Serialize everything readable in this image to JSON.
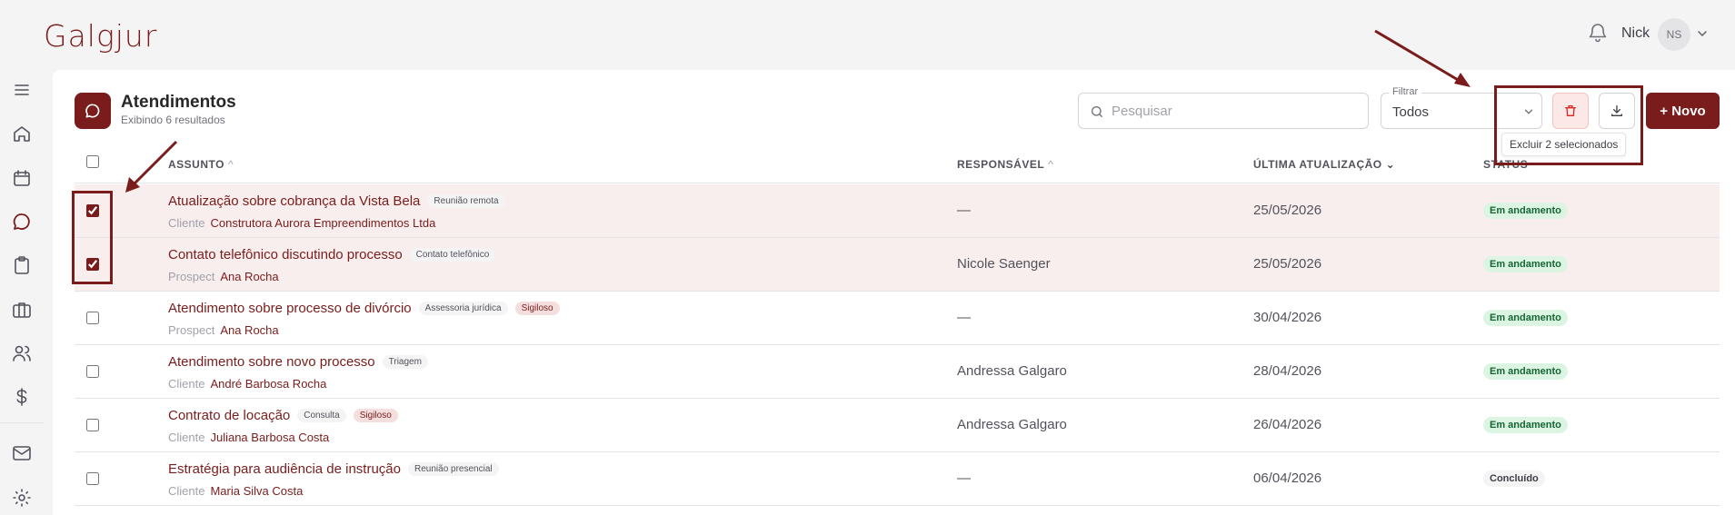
{
  "app": {
    "logo": "Galgjur"
  },
  "header": {
    "user_name": "Nick",
    "user_initials": "NS"
  },
  "sidebar": {
    "items": [
      {
        "name": "menu-icon"
      },
      {
        "name": "home-icon"
      },
      {
        "name": "calendar-icon"
      },
      {
        "name": "chat-icon",
        "active": true
      },
      {
        "name": "clipboard-icon"
      },
      {
        "name": "briefcase-icon"
      },
      {
        "name": "users-icon"
      },
      {
        "name": "dollar-icon"
      },
      {
        "name": "mail-icon"
      },
      {
        "name": "gear-icon"
      }
    ]
  },
  "page": {
    "title": "Atendimentos",
    "subtitle": "Exibindo 6 resultados"
  },
  "toolbar": {
    "search_placeholder": "Pesquisar",
    "filter_label": "Filtrar",
    "filter_value": "Todos",
    "delete_tooltip": "Excluir 2 selecionados",
    "new_label": "+ Novo"
  },
  "table": {
    "headers": {
      "subject": "ASSUNTO",
      "responsible": "RESPONSÁVEL",
      "updated": "ÚLTIMA ATUALIZAÇÃO",
      "status": "STATUS"
    },
    "rows": [
      {
        "selected": true,
        "title": "Atualização sobre cobrança da Vista Bela",
        "tags": [
          {
            "label": "Reunião remota",
            "kind": "normal"
          }
        ],
        "role": "Cliente",
        "person": "Construtora Aurora Empreendimentos Ltda",
        "responsible": "—",
        "date": "25/05/2026",
        "status": "Em andamento",
        "status_kind": "ongoing"
      },
      {
        "selected": true,
        "title": "Contato telefônico discutindo processo",
        "tags": [
          {
            "label": "Contato telefônico",
            "kind": "normal"
          }
        ],
        "role": "Prospect",
        "person": "Ana Rocha",
        "responsible": "Nicole Saenger",
        "date": "25/05/2026",
        "status": "Em andamento",
        "status_kind": "ongoing"
      },
      {
        "selected": false,
        "title": "Atendimento sobre processo de divórcio",
        "tags": [
          {
            "label": "Assessoria jurídica",
            "kind": "normal"
          },
          {
            "label": "Sigiloso",
            "kind": "sig"
          }
        ],
        "role": "Prospect",
        "person": "Ana Rocha",
        "responsible": "—",
        "date": "30/04/2026",
        "status": "Em andamento",
        "status_kind": "ongoing"
      },
      {
        "selected": false,
        "title": "Atendimento sobre novo processo",
        "tags": [
          {
            "label": "Triagem",
            "kind": "normal"
          }
        ],
        "role": "Cliente",
        "person": "André Barbosa Rocha",
        "responsible": "Andressa Galgaro",
        "date": "28/04/2026",
        "status": "Em andamento",
        "status_kind": "ongoing"
      },
      {
        "selected": false,
        "title": "Contrato de locação",
        "tags": [
          {
            "label": "Consulta",
            "kind": "normal"
          },
          {
            "label": "Sigiloso",
            "kind": "sig"
          }
        ],
        "role": "Cliente",
        "person": "Juliana Barbosa Costa",
        "responsible": "Andressa Galgaro",
        "date": "26/04/2026",
        "status": "Em andamento",
        "status_kind": "ongoing"
      },
      {
        "selected": false,
        "title": "Estratégia para audiência de instrução",
        "tags": [
          {
            "label": "Reunião presencial",
            "kind": "normal"
          }
        ],
        "role": "Cliente",
        "person": "Maria Silva Costa",
        "responsible": "—",
        "date": "06/04/2026",
        "status": "Concluído",
        "status_kind": "done"
      }
    ]
  },
  "colors": {
    "brand": "#7a1c1c",
    "ongoing": "#166534",
    "selected_row": "#f8eeee"
  }
}
